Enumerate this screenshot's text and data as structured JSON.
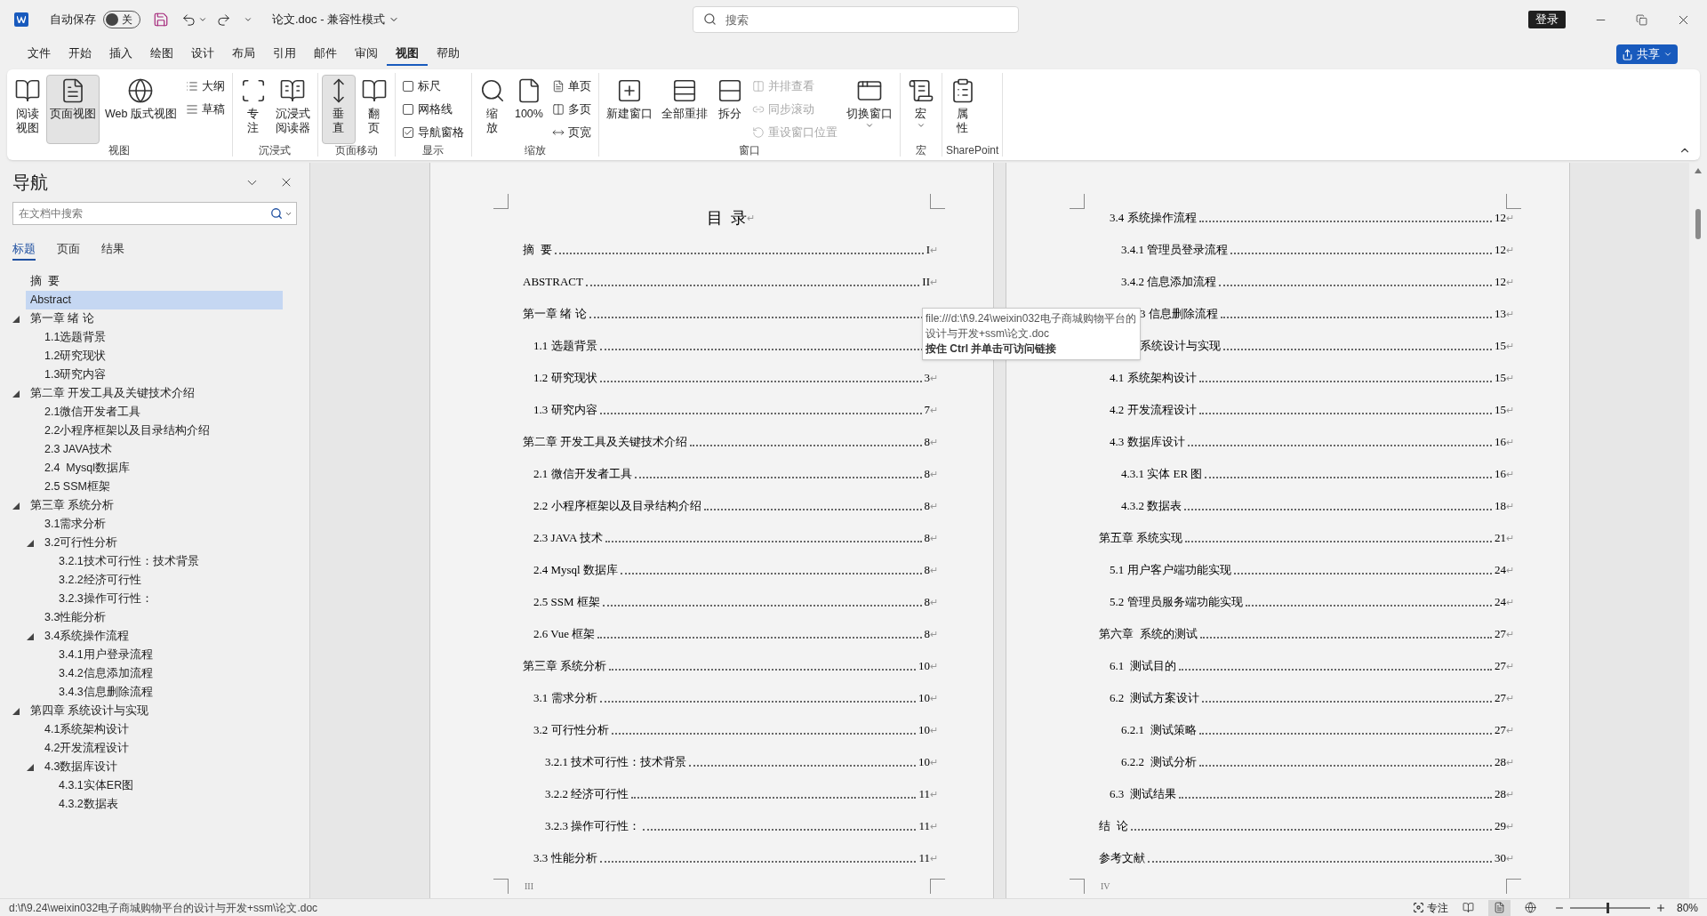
{
  "titlebar": {
    "autosave": {
      "label": "自动保存",
      "on": false,
      "state_label": "关"
    },
    "title": "论文.doc - 兼容性模式",
    "search": {
      "placeholder": "搜索"
    },
    "signin": "登录"
  },
  "menu": {
    "tabs": [
      {
        "label": "文件",
        "selected": false
      },
      {
        "label": "开始",
        "selected": false
      },
      {
        "label": "插入",
        "selected": false
      },
      {
        "label": "绘图",
        "selected": false
      },
      {
        "label": "设计",
        "selected": false
      },
      {
        "label": "布局",
        "selected": false
      },
      {
        "label": "引用",
        "selected": false
      },
      {
        "label": "邮件",
        "selected": false
      },
      {
        "label": "审阅",
        "selected": false
      },
      {
        "label": "视图",
        "selected": true
      },
      {
        "label": "帮助",
        "selected": false
      }
    ],
    "share": "共享"
  },
  "ribbon": {
    "groups": [
      {
        "label": "视图",
        "columns": [
          {
            "kind": "large",
            "lines": [
              "阅读",
              "视图"
            ],
            "selected": false,
            "dropdown": false
          },
          {
            "kind": "large",
            "lines": [
              "页面视图"
            ],
            "selected": true,
            "dropdown": false
          },
          {
            "kind": "large",
            "lines": [
              "Web 版式视图"
            ],
            "selected": false,
            "dropdown": false
          },
          {
            "kind": "stack",
            "items": [
              {
                "kind": "small",
                "label": "大纲",
                "disabled": false
              },
              {
                "kind": "small",
                "label": "草稿",
                "disabled": false
              }
            ]
          }
        ]
      },
      {
        "label": "沉浸式",
        "columns": [
          {
            "kind": "large",
            "lines": [
              "专",
              "注"
            ],
            "selected": false,
            "dropdown": false
          },
          {
            "kind": "large",
            "lines": [
              "沉浸式",
              "阅读器"
            ],
            "selected": false,
            "dropdown": false
          }
        ]
      },
      {
        "label": "页面移动",
        "columns": [
          {
            "kind": "large",
            "lines": [
              "垂",
              "直"
            ],
            "selected": true,
            "dropdown": false
          },
          {
            "kind": "large",
            "lines": [
              "翻",
              "页"
            ],
            "selected": false,
            "dropdown": false
          }
        ]
      },
      {
        "label": "显示",
        "columns": [
          {
            "kind": "stack",
            "items": [
              {
                "kind": "check",
                "label": "标尺",
                "checked": false
              },
              {
                "kind": "check",
                "label": "网格线",
                "checked": false
              },
              {
                "kind": "check",
                "label": "导航窗格",
                "checked": true
              }
            ]
          }
        ]
      },
      {
        "label": "缩放",
        "columns": [
          {
            "kind": "large",
            "lines": [
              "缩",
              "放"
            ],
            "selected": false,
            "dropdown": false
          },
          {
            "kind": "large",
            "lines": [
              "100%"
            ],
            "selected": false,
            "dropdown": false
          },
          {
            "kind": "stack",
            "items": [
              {
                "kind": "small",
                "label": "单页",
                "disabled": false
              },
              {
                "kind": "small",
                "label": "多页",
                "disabled": false
              },
              {
                "kind": "small",
                "label": "页宽",
                "disabled": false
              }
            ]
          }
        ]
      },
      {
        "label": "窗口",
        "columns": [
          {
            "kind": "large",
            "lines": [
              "新建窗口"
            ],
            "selected": false,
            "dropdown": false
          },
          {
            "kind": "large",
            "lines": [
              "全部重排"
            ],
            "selected": false,
            "dropdown": false
          },
          {
            "kind": "large",
            "lines": [
              "拆分"
            ],
            "selected": false,
            "dropdown": false
          },
          {
            "kind": "stack",
            "items": [
              {
                "kind": "small",
                "label": "并排查看",
                "disabled": true
              },
              {
                "kind": "small",
                "label": "同步滚动",
                "disabled": true
              },
              {
                "kind": "small",
                "label": "重设窗口位置",
                "disabled": true
              }
            ]
          },
          {
            "kind": "large",
            "lines": [
              "切换窗口"
            ],
            "selected": false,
            "dropdown": true
          }
        ]
      },
      {
        "label": "宏",
        "columns": [
          {
            "kind": "large",
            "lines": [
              "宏"
            ],
            "selected": false,
            "dropdown": true
          }
        ]
      },
      {
        "label": "SharePoint",
        "columns": [
          {
            "kind": "large",
            "lines": [
              "属",
              "性"
            ],
            "selected": false,
            "dropdown": false
          }
        ]
      }
    ]
  },
  "navigation": {
    "title": "导航",
    "search": {
      "placeholder": "在文档中搜索"
    },
    "tabs": [
      {
        "label": "标题",
        "selected": true
      },
      {
        "label": "页面",
        "selected": false
      },
      {
        "label": "结果",
        "selected": false
      }
    ],
    "tree": [
      {
        "label": "摘  要",
        "selected": false
      },
      {
        "label": "Abstract",
        "selected": true
      },
      {
        "label": "第一章 绪 论",
        "selected": false,
        "expanded": true,
        "children": [
          {
            "label": "1.1选题背景",
            "selected": false
          },
          {
            "label": "1.2研究现状",
            "selected": false
          },
          {
            "label": "1.3研究内容",
            "selected": false
          }
        ]
      },
      {
        "label": "第二章 开发工具及关键技术介绍",
        "selected": false,
        "expanded": true,
        "children": [
          {
            "label": "2.1微信开发者工具",
            "selected": false
          },
          {
            "label": "2.2小程序框架以及目录结构介绍",
            "selected": false
          },
          {
            "label": "2.3 JAVA技术",
            "selected": false
          },
          {
            "label": "2.4  Mysql数据库",
            "selected": false
          },
          {
            "label": "2.5 SSM框架",
            "selected": false
          }
        ]
      },
      {
        "label": "第三章 系统分析",
        "selected": false,
        "expanded": true,
        "children": [
          {
            "label": "3.1需求分析",
            "selected": false
          },
          {
            "label": "3.2可行性分析",
            "selected": false,
            "expanded": true,
            "children": [
              {
                "label": "3.2.1技术可行性：技术背景",
                "selected": false
              },
              {
                "label": "3.2.2经济可行性",
                "selected": false
              },
              {
                "label": "3.2.3操作可行性：",
                "selected": false
              }
            ]
          },
          {
            "label": "3.3性能分析",
            "selected": false
          },
          {
            "label": "3.4系统操作流程",
            "selected": false,
            "expanded": true,
            "children": [
              {
                "label": "3.4.1用户登录流程",
                "selected": false
              },
              {
                "label": "3.4.2信息添加流程",
                "selected": false
              },
              {
                "label": "3.4.3信息删除流程",
                "selected": false
              }
            ]
          }
        ]
      },
      {
        "label": "第四章 系统设计与实现",
        "selected": false,
        "expanded": true,
        "children": [
          {
            "label": "4.1系统架构设计",
            "selected": false
          },
          {
            "label": "4.2开发流程设计",
            "selected": false
          },
          {
            "label": "4.3数据库设计",
            "selected": false,
            "expanded": true,
            "children": [
              {
                "label": "4.3.1实体ER图",
                "selected": false
              },
              {
                "label": "4.3.2数据表",
                "selected": false
              }
            ]
          }
        ]
      }
    ]
  },
  "pages": [
    {
      "title": {
        "text": "目  录",
        "mark": "↵"
      },
      "footer": "III",
      "entries": [
        {
          "kind": "chapter",
          "text": "摘  要",
          "page": "I",
          "mark": "↵"
        },
        {
          "kind": "chapter",
          "text": "ABSTRACT",
          "page": "II",
          "mark": "↵"
        },
        {
          "kind": "chapter",
          "text": "第一章 绪 论"
        },
        {
          "kind": "section",
          "text": "1.1 选题背景"
        },
        {
          "kind": "section",
          "text": "1.2 研究现状",
          "page": "3",
          "mark": "↵"
        },
        {
          "kind": "section",
          "text": "1.3 研究内容",
          "page": "7",
          "mark": "↵"
        },
        {
          "kind": "chapter",
          "text": "第二章 开发工具及关键技术介绍",
          "page": "8",
          "mark": "↵"
        },
        {
          "kind": "section",
          "text": "2.1 微信开发者工具",
          "page": "8",
          "mark": "↵"
        },
        {
          "kind": "section",
          "text": "2.2 小程序框架以及目录结构介绍",
          "page": "8",
          "mark": "↵"
        },
        {
          "kind": "section",
          "text": "2.3 JAVA 技术",
          "page": "8",
          "mark": "↵"
        },
        {
          "kind": "section",
          "text": "2.4 Mysql 数据库",
          "page": "8",
          "mark": "↵"
        },
        {
          "kind": "section",
          "text": "2.5 SSM 框架",
          "page": "8",
          "mark": "↵"
        },
        {
          "kind": "section",
          "text": "2.6 Vue 框架",
          "page": "8",
          "mark": "↵"
        },
        {
          "kind": "chapter",
          "text": "第三章 系统分析",
          "page": "10",
          "mark": "↵"
        },
        {
          "kind": "section",
          "text": "3.1 需求分析",
          "page": "10",
          "mark": "↵"
        },
        {
          "kind": "section",
          "text": "3.2 可行性分析",
          "page": "10",
          "mark": "↵"
        },
        {
          "kind": "subsection",
          "text": "3.2.1 技术可行性：技术背景",
          "page": "10",
          "mark": "↵"
        },
        {
          "kind": "subsection",
          "text": "3.2.2 经济可行性",
          "page": "11",
          "mark": "↵"
        },
        {
          "kind": "subsection",
          "text": "3.2.3 操作可行性：",
          "page": "11",
          "mark": "↵"
        },
        {
          "kind": "section",
          "text": "3.3 性能分析",
          "page": "11",
          "mark": "↵"
        }
      ]
    },
    {
      "footer": "IV",
      "entries": [
        {
          "kind": "section",
          "text": "3.4 系统操作流程",
          "page": "12",
          "mark": "↵"
        },
        {
          "kind": "subsection",
          "text": "3.4.1 管理员登录流程",
          "page": "12",
          "mark": "↵"
        },
        {
          "kind": "subsection",
          "text": "3.4.2 信息添加流程",
          "page": "12",
          "mark": "↵"
        },
        {
          "kind": "clipped",
          "text": "3 信息删除流程",
          "page": "13",
          "mark": "↵"
        },
        {
          "kind": "clipped",
          "text": "系统设计与实现",
          "page": "15",
          "mark": "↵"
        },
        {
          "kind": "section",
          "text": "4.1 系统架构设计",
          "page": "15",
          "mark": "↵"
        },
        {
          "kind": "section",
          "text": "4.2 开发流程设计",
          "page": "15",
          "mark": "↵"
        },
        {
          "kind": "section",
          "text": "4.3 数据库设计",
          "page": "16",
          "mark": "↵"
        },
        {
          "kind": "subsection",
          "text": "4.3.1 实体 ER 图",
          "page": "16",
          "mark": "↵"
        },
        {
          "kind": "subsection",
          "text": "4.3.2 数据表",
          "page": "18",
          "mark": "↵"
        },
        {
          "kind": "chapter",
          "text": "第五章 系统实现",
          "page": "21",
          "mark": "↵"
        },
        {
          "kind": "section",
          "text": "5.1 用户客户端功能实现",
          "page": "24",
          "mark": "↵"
        },
        {
          "kind": "section",
          "text": "5.2 管理员服务端功能实现",
          "page": "24",
          "mark": "↵"
        },
        {
          "kind": "chapter",
          "text": "第六章  系统的测试",
          "page": "27",
          "mark": "↵"
        },
        {
          "kind": "section",
          "text": "6.1  测试目的",
          "page": "27",
          "mark": "↵"
        },
        {
          "kind": "section",
          "text": "6.2  测试方案设计",
          "page": "27",
          "mark": "↵"
        },
        {
          "kind": "subsection",
          "text": "6.2.1  测试策略",
          "page": "27",
          "mark": "↵"
        },
        {
          "kind": "subsection",
          "text": "6.2.2  测试分析",
          "page": "28",
          "mark": "↵"
        },
        {
          "kind": "section",
          "text": "6.3  测试结果",
          "page": "28",
          "mark": "↵"
        },
        {
          "kind": "chapter",
          "text": "结  论",
          "page": "29",
          "mark": "↵"
        },
        {
          "kind": "chapter",
          "text": "参考文献",
          "page": "30",
          "mark": "↵"
        }
      ]
    }
  ],
  "tooltip": {
    "path": "file:///d:\\f\\9.24\\weixin032电子商城购物平台的设计与开发+ssm\\论文.doc",
    "hint": "按住 Ctrl 并单击可访问链接"
  },
  "status_bar": {
    "path": "d:\\f\\9.24\\weixin032电子商城购物平台的设计与开发+ssm\\论文.doc",
    "focus": "专注",
    "views": [
      {
        "selected": false
      },
      {
        "selected": true
      },
      {
        "selected": false
      }
    ],
    "zoom": {
      "level": 0.47,
      "reading": "80%"
    }
  }
}
